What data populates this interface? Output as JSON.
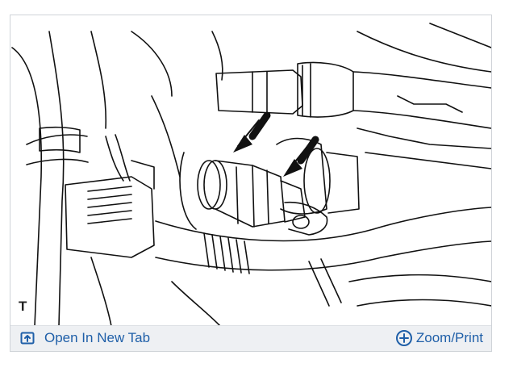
{
  "figure": {
    "corner_label": "T"
  },
  "toolbar": {
    "open_new_tab_label": "Open In New Tab",
    "zoom_print_label": "Zoom/Print",
    "open_icon": "open-in-new-tab-icon",
    "zoom_icon": "plus-circle-icon",
    "link_color": "#1f5fa8"
  }
}
